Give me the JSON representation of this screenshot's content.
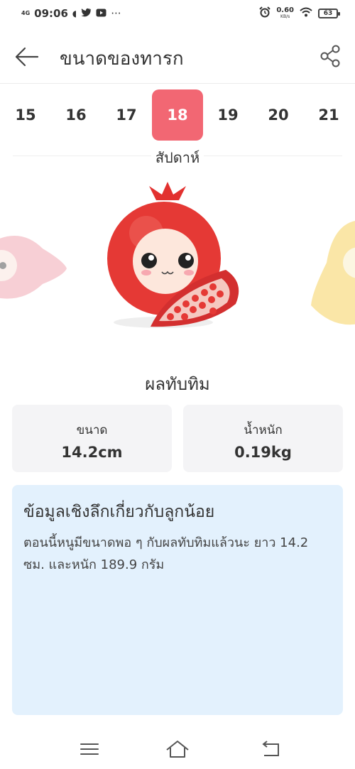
{
  "status_bar": {
    "network": "4G",
    "time": "09:06",
    "more": "···",
    "speed_value": "0.60",
    "speed_unit": "KB/s",
    "battery": "63"
  },
  "header": {
    "title": "ขนาดของทารก"
  },
  "weeks": {
    "items": [
      "15",
      "16",
      "17",
      "18",
      "19",
      "20",
      "21"
    ],
    "selected": "18",
    "label": "สัปดาห์"
  },
  "fruit": {
    "name": "ผลทับทิม"
  },
  "stats": {
    "size_label": "ขนาด",
    "size_value": "14.2cm",
    "weight_label": "น้ำหนัก",
    "weight_value": "0.19kg"
  },
  "info": {
    "title": "ข้อมูลเชิงลึกเกี่ยวกับลูกน้อย",
    "body": "ตอนนี้หนูมีขนาดพอ ๆ กับผลทับทิมแล้วนะ ยาว 14.2 ซม. และหนัก 189.9 กรัม"
  },
  "colors": {
    "accent": "#f26773",
    "info_bg": "#e3f1fd",
    "card_bg": "#f4f4f6"
  }
}
